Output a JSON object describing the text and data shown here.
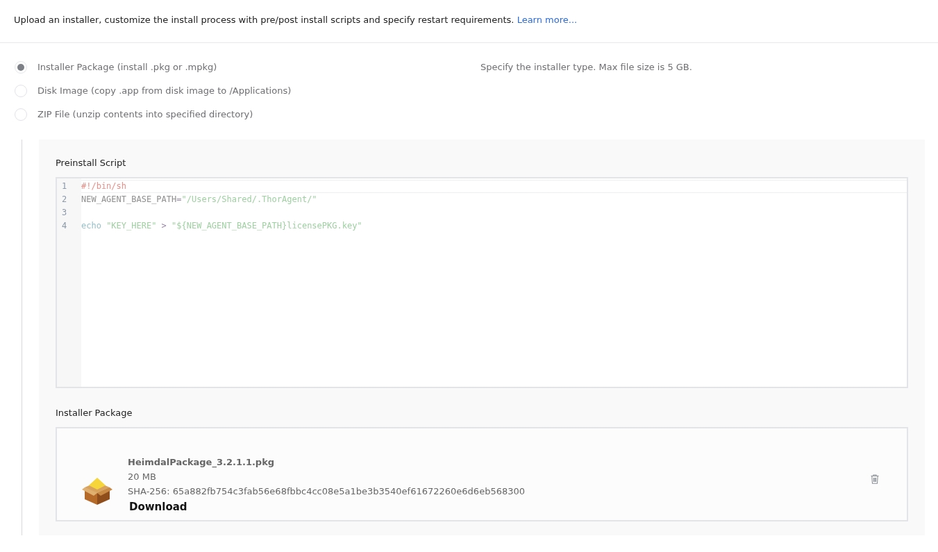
{
  "intro": {
    "text": "Upload an installer, customize the install process with pre/post install scripts and specify restart requirements.",
    "link": "Learn more..."
  },
  "installer_types": [
    {
      "label": "Installer Package (install .pkg or .mpkg)",
      "selected": true
    },
    {
      "label": "Disk Image (copy .app from disk image to /Applications)",
      "selected": false
    },
    {
      "label": "ZIP File (unzip contents into specified directory)",
      "selected": false
    }
  ],
  "installer_type_hint": "Specify the installer type. Max file size is 5 GB.",
  "preinstall_script": {
    "label": "Preinstall Script",
    "lines": [
      {
        "number": "1",
        "active": true,
        "tokens": [
          {
            "text": "#!/bin/sh",
            "kind": "comment"
          }
        ]
      },
      {
        "number": "2",
        "active": false,
        "tokens": [
          {
            "text": "NEW_AGENT_BASE_PATH",
            "kind": "variable"
          },
          {
            "text": "=",
            "kind": "operator"
          },
          {
            "text": "\"/Users/Shared/.ThorAgent/\"",
            "kind": "string"
          }
        ]
      },
      {
        "number": "3",
        "active": false
      },
      {
        "number": "4",
        "active": false,
        "tokens": [
          {
            "text": "echo",
            "kind": "builtin"
          },
          {
            "text": "\"KEY_HERE\"",
            "kind": "string"
          },
          {
            "text": " > ",
            "kind": "operator"
          },
          {
            "text": "\"${NEW_AGENT_BASE_PATH}licensePKG.key\"",
            "kind": "string"
          }
        ]
      }
    ]
  },
  "installer_package": {
    "label": "Installer Package",
    "file_name": "HeimdalPackage_3.2.1.1.pkg",
    "size": "20 MB",
    "hash": "SHA-256: 65a882fb754c3fab56e68fbbc4cc08e5a1be3b3540ef61672260e6d6eb568300",
    "download": "Download"
  }
}
